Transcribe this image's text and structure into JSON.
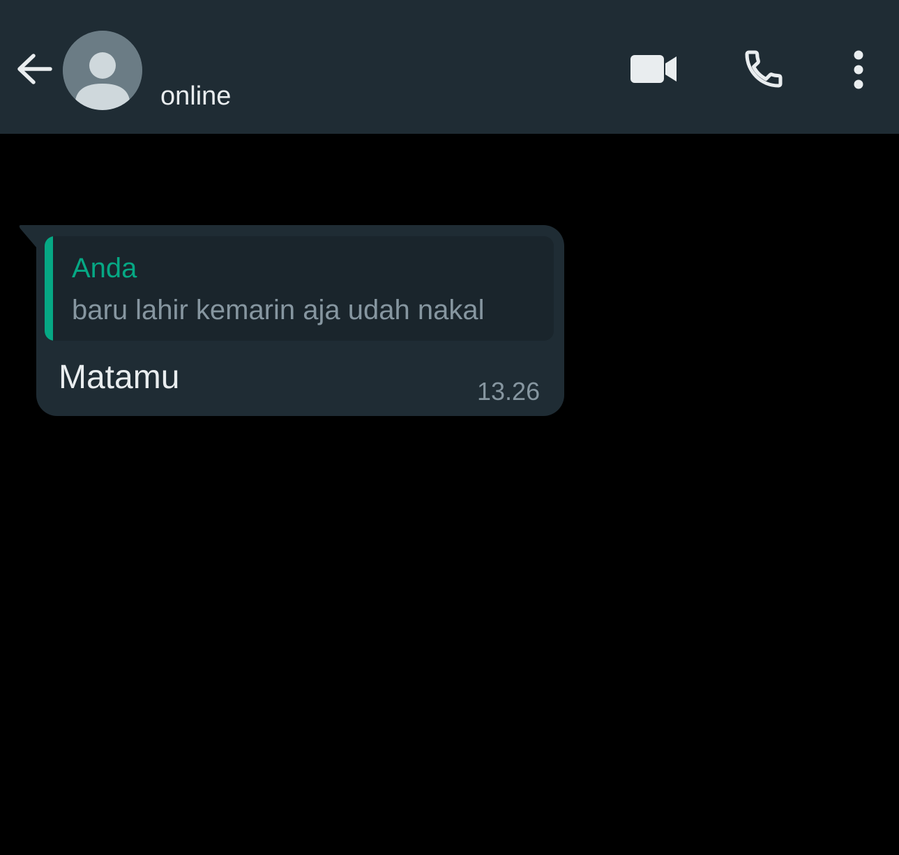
{
  "header": {
    "back_icon": "arrow-left-icon",
    "avatar_icon": "default-person-avatar-icon",
    "status": "online",
    "video_icon": "video-camera-icon",
    "call_icon": "phone-icon",
    "menu_icon": "more-vertical-icon"
  },
  "message": {
    "quote": {
      "author": "Anda",
      "text": "baru lahir kemarin aja udah nakal"
    },
    "text": "Matamu",
    "time": "13.26"
  },
  "colors": {
    "header_background": "#1f2c34",
    "chat_background": "#000000",
    "bubble_background": "#1f2c34",
    "quote_background": "#1a252c",
    "accent": "#06a884",
    "primary_text": "#e9edef",
    "secondary_text": "#8696a0"
  }
}
